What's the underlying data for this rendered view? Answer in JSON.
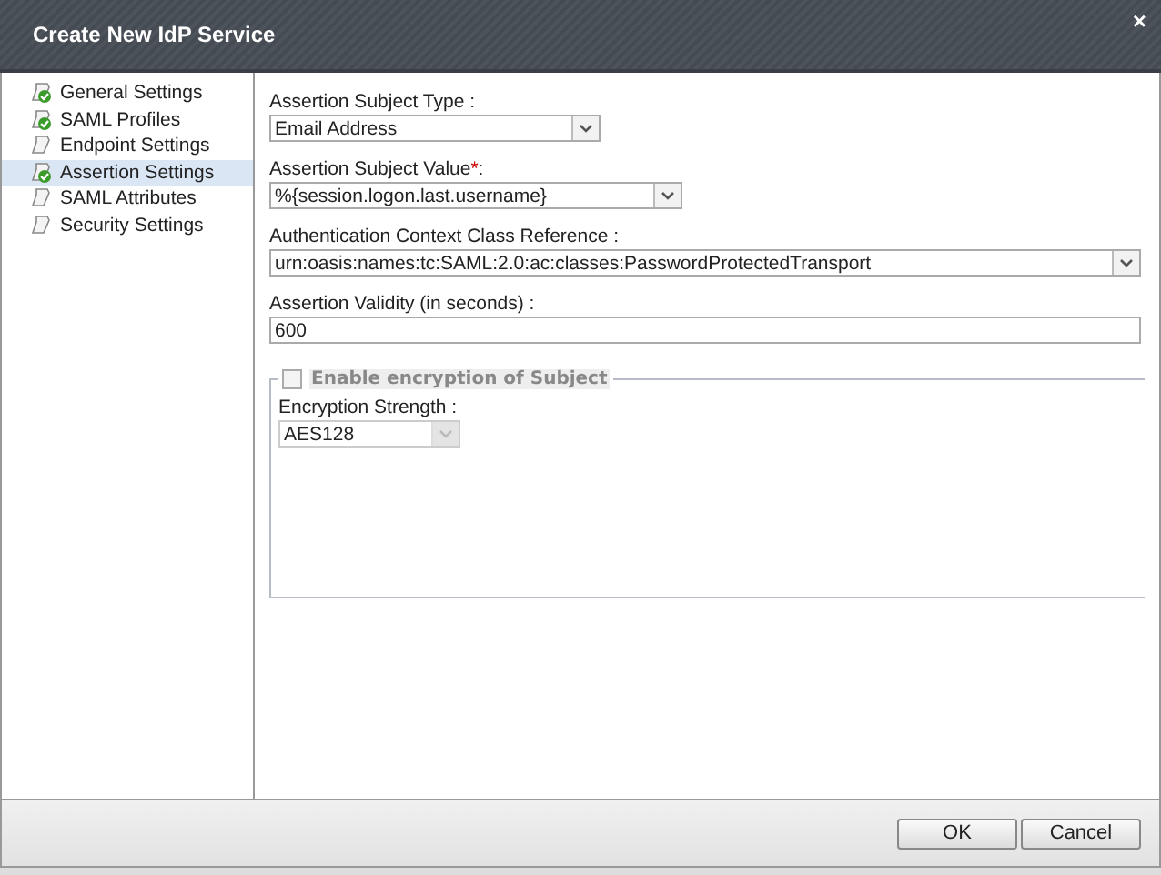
{
  "window": {
    "title": "Create New IdP Service",
    "close": "×"
  },
  "sidebar": {
    "items": [
      {
        "label": "General Settings",
        "complete": true,
        "selected": false
      },
      {
        "label": "SAML Profiles",
        "complete": true,
        "selected": false
      },
      {
        "label": "Endpoint Settings",
        "complete": false,
        "selected": false
      },
      {
        "label": "Assertion Settings",
        "complete": true,
        "selected": true
      },
      {
        "label": "SAML Attributes",
        "complete": false,
        "selected": false
      },
      {
        "label": "Security Settings",
        "complete": false,
        "selected": false
      }
    ]
  },
  "form": {
    "fields": [
      {
        "kind": "select",
        "label": "Assertion Subject Type",
        "suffix": " :",
        "value": "Email Address"
      },
      {
        "kind": "select",
        "label": "Assertion Subject Value",
        "required_mark": "*",
        "suffix": ":",
        "value": "%{session.logon.last.username}"
      },
      {
        "kind": "select",
        "label": "Authentication Context Class Reference",
        "suffix": " :",
        "value": "urn:oasis:names:tc:SAML:2.0:ac:classes:PasswordProtectedTransport"
      },
      {
        "kind": "text",
        "label": "Assertion Validity (in seconds)",
        "suffix": " :",
        "value": "600"
      }
    ],
    "encryption": {
      "label": "Enable encryption of Subject",
      "checked": false,
      "strength_label": "Encryption Strength",
      "strength_suffix": " :",
      "strength_value": "AES128",
      "disabled": true
    }
  },
  "buttons": [
    "OK",
    "Cancel"
  ]
}
